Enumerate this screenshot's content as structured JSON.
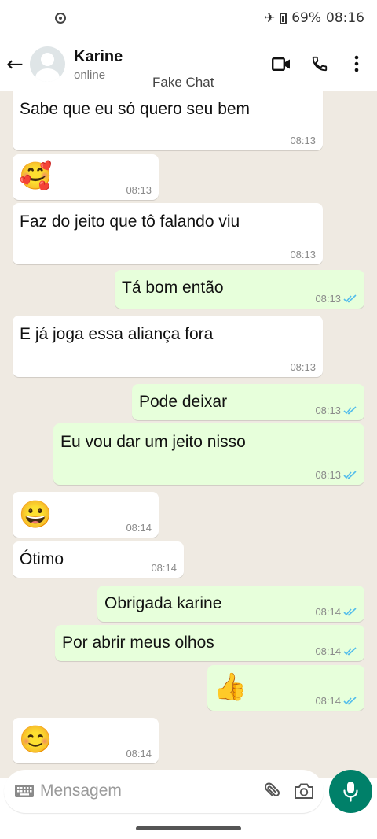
{
  "status_bar": {
    "battery": "69%",
    "time": "08:16"
  },
  "header": {
    "contact_name": "Karine",
    "contact_status": "online",
    "app_name": "Fake Chat"
  },
  "messages": [
    {
      "dir": "in",
      "text": "Sabe que eu só quero seu bem",
      "time": "08:13"
    },
    {
      "dir": "in",
      "emoji": "🥰",
      "time": "08:13"
    },
    {
      "dir": "in",
      "text": "Faz do jeito que tô falando viu",
      "time": "08:13"
    },
    {
      "dir": "out",
      "text": "Tá bom então",
      "time": "08:13"
    },
    {
      "dir": "in",
      "text": "E já joga essa aliança fora",
      "time": "08:13"
    },
    {
      "dir": "out",
      "text": "Pode deixar",
      "time": "08:13"
    },
    {
      "dir": "out",
      "text": "Eu vou dar um jeito nisso",
      "time": "08:13"
    },
    {
      "dir": "in",
      "emoji": "😀",
      "time": "08:14"
    },
    {
      "dir": "in",
      "text": "Ótimo",
      "time": "08:14"
    },
    {
      "dir": "out",
      "text": "Obrigada karine",
      "time": "08:14"
    },
    {
      "dir": "out",
      "text": "Por abrir meus olhos",
      "time": "08:14"
    },
    {
      "dir": "out",
      "emoji": "👍",
      "time": "08:14"
    },
    {
      "dir": "in",
      "emoji": "😊",
      "time": "08:14"
    }
  ],
  "composer": {
    "placeholder": "Mensagem"
  },
  "colors": {
    "accent": "#008069",
    "outgoing": "#e7ffdb",
    "incoming": "#ffffff",
    "chat_bg": "#efeae2",
    "read_ticks": "#53bdeb"
  }
}
